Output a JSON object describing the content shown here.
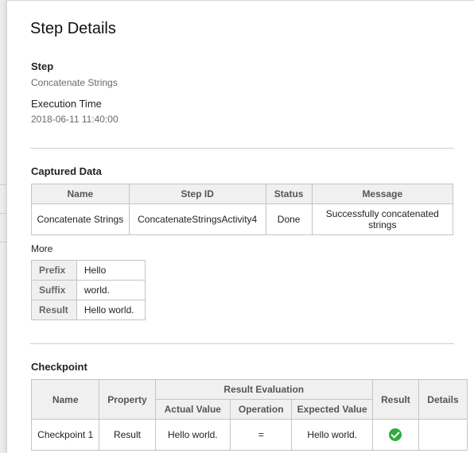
{
  "header": {
    "title": "Step Details"
  },
  "step": {
    "label": "Step",
    "value": "Concatenate Strings"
  },
  "execution_time": {
    "label": "Execution Time",
    "value": "2018-06-11 11:40:00"
  },
  "captured_data": {
    "heading": "Captured Data",
    "columns": [
      "Name",
      "Step ID",
      "Status",
      "Message"
    ],
    "rows": [
      [
        "Concatenate Strings",
        "ConcatenateStringsActivity4",
        "Done",
        "Successfully concatenated strings"
      ]
    ]
  },
  "more": {
    "label": "More",
    "rows": [
      {
        "key": "Prefix",
        "value": "Hello"
      },
      {
        "key": "Suffix",
        "value": "world."
      },
      {
        "key": "Result",
        "value": "Hello world."
      }
    ]
  },
  "checkpoint": {
    "heading": "Checkpoint",
    "columns": {
      "name": "Name",
      "property": "Property",
      "evaluation": "Result Evaluation",
      "actual": "Actual Value",
      "operation": "Operation",
      "expected": "Expected Value",
      "result": "Result",
      "details": "Details"
    },
    "rows": [
      {
        "name": "Checkpoint 1",
        "property": "Result",
        "actual": "Hello world.",
        "operation": "=",
        "expected": "Hello world.",
        "result_icon": "check-circle-icon",
        "details": ""
      }
    ],
    "colors": {
      "pass": "#2eab3c"
    }
  }
}
